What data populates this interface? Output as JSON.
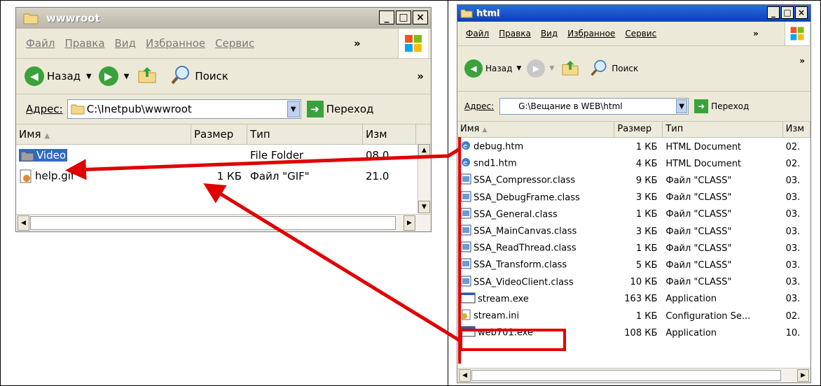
{
  "left_window": {
    "title": "wwwroot",
    "menu": [
      "Файл",
      "Правка",
      "Вид",
      "Избранное",
      "Сервис"
    ],
    "menu_more": "»",
    "toolbar": {
      "back": "Назад",
      "search": "Поиск",
      "more": "»"
    },
    "address": {
      "label": "Адрес:",
      "value": "C:\\Inetpub\\wwwroot",
      "go": "Переход"
    },
    "columns": [
      "Имя",
      "Размер",
      "Тип",
      "Изм"
    ],
    "rows": [
      {
        "name": "Video",
        "size": "",
        "type": "File Folder",
        "date": "08.0"
      },
      {
        "name": "help.gif",
        "size": "1 КБ",
        "type": "Файл \"GIF\"",
        "date": "21.0"
      }
    ]
  },
  "right_window": {
    "title": "html",
    "menu": [
      "Файл",
      "Правка",
      "Вид",
      "Избранное",
      "Сервис"
    ],
    "menu_more": "»",
    "toolbar": {
      "back": "Назад",
      "search": "Поиск",
      "more": "»"
    },
    "address": {
      "label": "Адрес:",
      "value": "G:\\Вещание в WEB\\html",
      "go": "Переход"
    },
    "columns": [
      "Имя",
      "Размер",
      "Тип",
      "Изм"
    ],
    "rows": [
      {
        "name": "debug.htm",
        "size": "1 КБ",
        "type": "HTML Document",
        "date": "02.",
        "icon": "ie"
      },
      {
        "name": "snd1.htm",
        "size": "4 КБ",
        "type": "HTML Document",
        "date": "02.",
        "icon": "ie"
      },
      {
        "name": "SSA_Compressor.class",
        "size": "9 КБ",
        "type": "Файл \"CLASS\"",
        "date": "03.",
        "icon": "cls"
      },
      {
        "name": "SSA_DebugFrame.class",
        "size": "3 КБ",
        "type": "Файл \"CLASS\"",
        "date": "03.",
        "icon": "cls"
      },
      {
        "name": "SSA_General.class",
        "size": "1 КБ",
        "type": "Файл \"CLASS\"",
        "date": "03.",
        "icon": "cls"
      },
      {
        "name": "SSA_MainCanvas.class",
        "size": "3 КБ",
        "type": "Файл \"CLASS\"",
        "date": "03.",
        "icon": "cls"
      },
      {
        "name": "SSA_ReadThread.class",
        "size": "1 КБ",
        "type": "Файл \"CLASS\"",
        "date": "03.",
        "icon": "cls"
      },
      {
        "name": "SSA_Transform.class",
        "size": "5 КБ",
        "type": "Файл \"CLASS\"",
        "date": "03.",
        "icon": "cls"
      },
      {
        "name": "SSA_VideoClient.class",
        "size": "10 КБ",
        "type": "Файл \"CLASS\"",
        "date": "03.",
        "icon": "cls"
      },
      {
        "name": "stream.exe",
        "size": "163 КБ",
        "type": "Application",
        "date": "03.",
        "icon": "exe"
      },
      {
        "name": "stream.ini",
        "size": "1 КБ",
        "type": "Configuration Se...",
        "date": "02.",
        "icon": "ini"
      },
      {
        "name": "web701.exe",
        "size": "108 КБ",
        "type": "Application",
        "date": "10.",
        "icon": "exe"
      }
    ]
  },
  "annotation_color": "#e00000"
}
